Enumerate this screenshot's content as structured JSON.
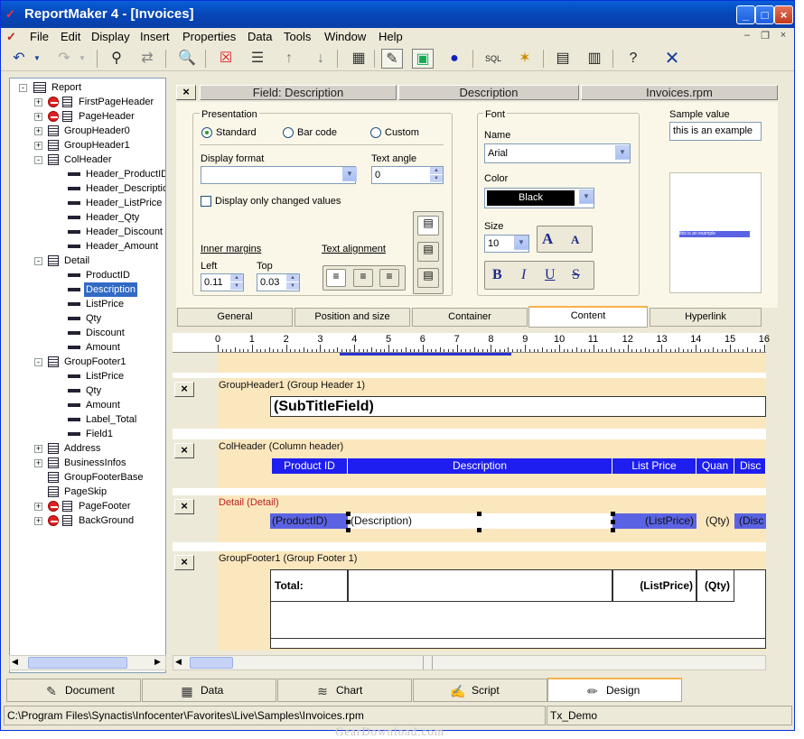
{
  "window": {
    "title": "ReportMaker 4 - [Invoices]"
  },
  "menu": [
    "File",
    "Edit",
    "Display",
    "Insert",
    "Properties",
    "Data",
    "Tools",
    "Window",
    "Help"
  ],
  "toolbar_icons": [
    "undo-icon",
    "dropdown-icon",
    "redo-icon",
    "dropdown-icon",
    "binoculars-icon",
    "link-icon",
    "zoom-icon",
    "delete-band-icon",
    "band-icon",
    "move-up-icon",
    "move-down-icon",
    "calculator-icon",
    "select-icon",
    "image-icon",
    "globe-icon",
    "sql-icon",
    "wand-icon",
    "save-icon",
    "save-as-icon",
    "help-icon",
    "close-icon"
  ],
  "tree": {
    "root": "Report",
    "items": [
      {
        "label": "FirstPageHeader",
        "icon": "error-icon",
        "level": 1,
        "expander": "+"
      },
      {
        "label": "PageHeader",
        "icon": "error-icon",
        "level": 1,
        "expander": "+"
      },
      {
        "label": "GroupHeader0",
        "icon": "list-icon",
        "level": 1,
        "expander": "+"
      },
      {
        "label": "GroupHeader1",
        "icon": "list-icon",
        "level": 1,
        "expander": "+"
      },
      {
        "label": "ColHeader",
        "icon": "list-icon",
        "level": 1,
        "expander": "-"
      },
      {
        "label": "Header_ProductID",
        "icon": "field-icon",
        "level": 2
      },
      {
        "label": "Header_Description",
        "icon": "field-icon",
        "level": 2
      },
      {
        "label": "Header_ListPrice",
        "icon": "field-icon",
        "level": 2
      },
      {
        "label": "Header_Qty",
        "icon": "field-icon",
        "level": 2
      },
      {
        "label": "Header_Discount",
        "icon": "field-icon",
        "level": 2
      },
      {
        "label": "Header_Amount",
        "icon": "field-icon",
        "level": 2
      },
      {
        "label": "Detail",
        "icon": "list-icon",
        "level": 1,
        "expander": "-"
      },
      {
        "label": "ProductID",
        "icon": "field-icon",
        "level": 2
      },
      {
        "label": "Description",
        "icon": "field-icon",
        "level": 2,
        "selected": true
      },
      {
        "label": "ListPrice",
        "icon": "field-icon",
        "level": 2
      },
      {
        "label": "Qty",
        "icon": "field-icon",
        "level": 2
      },
      {
        "label": "Discount",
        "icon": "field-icon",
        "level": 2
      },
      {
        "label": "Amount",
        "icon": "field-icon",
        "level": 2
      },
      {
        "label": "GroupFooter1",
        "icon": "list-icon",
        "level": 1,
        "expander": "-"
      },
      {
        "label": "ListPrice",
        "icon": "field-icon",
        "level": 2
      },
      {
        "label": "Qty",
        "icon": "field-icon",
        "level": 2
      },
      {
        "label": "Amount",
        "icon": "field-icon",
        "level": 2
      },
      {
        "label": "Label_Total",
        "icon": "field-icon",
        "level": 2
      },
      {
        "label": "Field1",
        "icon": "field-icon",
        "level": 2
      },
      {
        "label": "Address",
        "icon": "list-icon",
        "level": 1,
        "expander": "+"
      },
      {
        "label": "BusinessInfos",
        "icon": "list-icon",
        "level": 1,
        "expander": "+"
      },
      {
        "label": "GroupFooterBase",
        "icon": "list-icon",
        "level": 1
      },
      {
        "label": "PageSkip",
        "icon": "list-icon",
        "level": 1
      },
      {
        "label": "PageFooter",
        "icon": "error-icon",
        "level": 1,
        "expander": "+"
      },
      {
        "label": "BackGround",
        "icon": "error-icon",
        "level": 1,
        "expander": "+"
      }
    ]
  },
  "panel": {
    "close": "×",
    "header": [
      "Field: Description",
      "Description",
      "Invoices.rpm"
    ],
    "presentation": {
      "legend": "Presentation",
      "options": [
        "Standard",
        "Bar code",
        "Custom"
      ],
      "selected": "Standard"
    },
    "display_format": {
      "label": "Display format",
      "value": ""
    },
    "text_angle": {
      "label": "Text angle",
      "value": "0"
    },
    "changed_only": {
      "label": "Display only changed values",
      "checked": false
    },
    "inner_margins": {
      "label": "Inner margins",
      "left_label": "Left",
      "left": "0.11",
      "top_label": "Top",
      "top": "0.03"
    },
    "text_alignment": {
      "label": "Text alignment"
    },
    "font": {
      "legend": "Font",
      "name_label": "Name",
      "name": "Arial",
      "color_label": "Color",
      "color": "Black",
      "size_label": "Size",
      "size": "10"
    },
    "sample": {
      "label": "Sample value",
      "value": "this is an example",
      "preview": "this is an example"
    },
    "tabs": [
      "General",
      "Position and size",
      "Container",
      "Content",
      "Hyperlink"
    ],
    "active_tab": "Content"
  },
  "ruler": [
    "0",
    "1",
    "2",
    "3",
    "4",
    "5",
    "6",
    "7",
    "8",
    "9",
    "10",
    "11",
    "12",
    "13",
    "14",
    "15",
    "16"
  ],
  "bands": {
    "gh1": {
      "title": "GroupHeader1  (Group Header 1)",
      "field": "(SubTitleField)"
    },
    "col": {
      "title": "ColHeader  (Column header)",
      "cols": [
        "Product ID",
        "Description",
        "List Price",
        "Quan",
        "Disc"
      ]
    },
    "detail": {
      "title": "Detail  (Detail)",
      "fields": [
        "(ProductID)",
        "(Description)",
        "(ListPrice)",
        "(Qty)",
        "(Disc"
      ]
    },
    "gf1": {
      "title": "GroupFooter1  (Group Footer 1)",
      "total": "Total:",
      "listprice": "(ListPrice)",
      "qty": "(Qty)"
    }
  },
  "bottom_tabs": [
    {
      "label": "Document",
      "icon": "document-icon"
    },
    {
      "label": "Data",
      "icon": "data-icon"
    },
    {
      "label": "Chart",
      "icon": "chart-icon"
    },
    {
      "label": "Script",
      "icon": "script-icon"
    },
    {
      "label": "Design",
      "icon": "design-icon"
    }
  ],
  "active_bottom_tab": "Design",
  "status": {
    "path": "C:\\Program Files\\Synactis\\Infocenter\\Favorites\\Live\\Samples\\Invoices.rpm",
    "name": "Tx_Demo"
  },
  "watermark": "GearDownload.com"
}
